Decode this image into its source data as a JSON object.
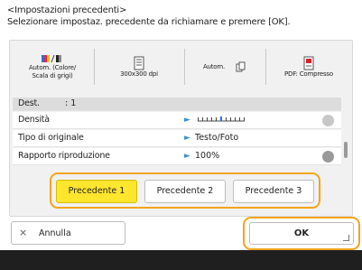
{
  "header": {
    "title": "<Impostazioni precedenti>",
    "instruction": "Selezionare impostaz. precedente da richiamare e premere [OK]."
  },
  "settings_icons": [
    {
      "label_line1": "Autom. (Colore/",
      "label_line2": "Scala di grigi)",
      "icon": "color-mode-icon"
    },
    {
      "label_line1": "300x300 dpi",
      "label_line2": "",
      "icon": "resolution-icon"
    },
    {
      "label_line1": "Autom.",
      "label_line2": "",
      "icon": "copy-icon"
    },
    {
      "label_line1": "PDF: Compresso",
      "label_line2": "",
      "icon": "pdf-icon"
    }
  ],
  "list": {
    "destination": {
      "label": "Dest.",
      "value": ": 1"
    },
    "rows": [
      {
        "label": "Densità",
        "value": ""
      },
      {
        "label": "Tipo di originale",
        "value": "Testo/Foto"
      },
      {
        "label": "Rapporto riproduzione",
        "value": "100%"
      }
    ]
  },
  "presets": [
    {
      "label": "Precedente 1",
      "selected": true
    },
    {
      "label": "Precedente 2",
      "selected": false
    },
    {
      "label": "Precedente 3",
      "selected": false
    }
  ],
  "buttons": {
    "cancel_icon": "×",
    "cancel_label": "Annulla",
    "ok_label": "OK"
  },
  "colors": {
    "highlight_ring": "#f2a51c",
    "selected_preset": "#ffe62e",
    "accent_arrow": "#3a8fd6",
    "footer": "#1f1f1f"
  }
}
